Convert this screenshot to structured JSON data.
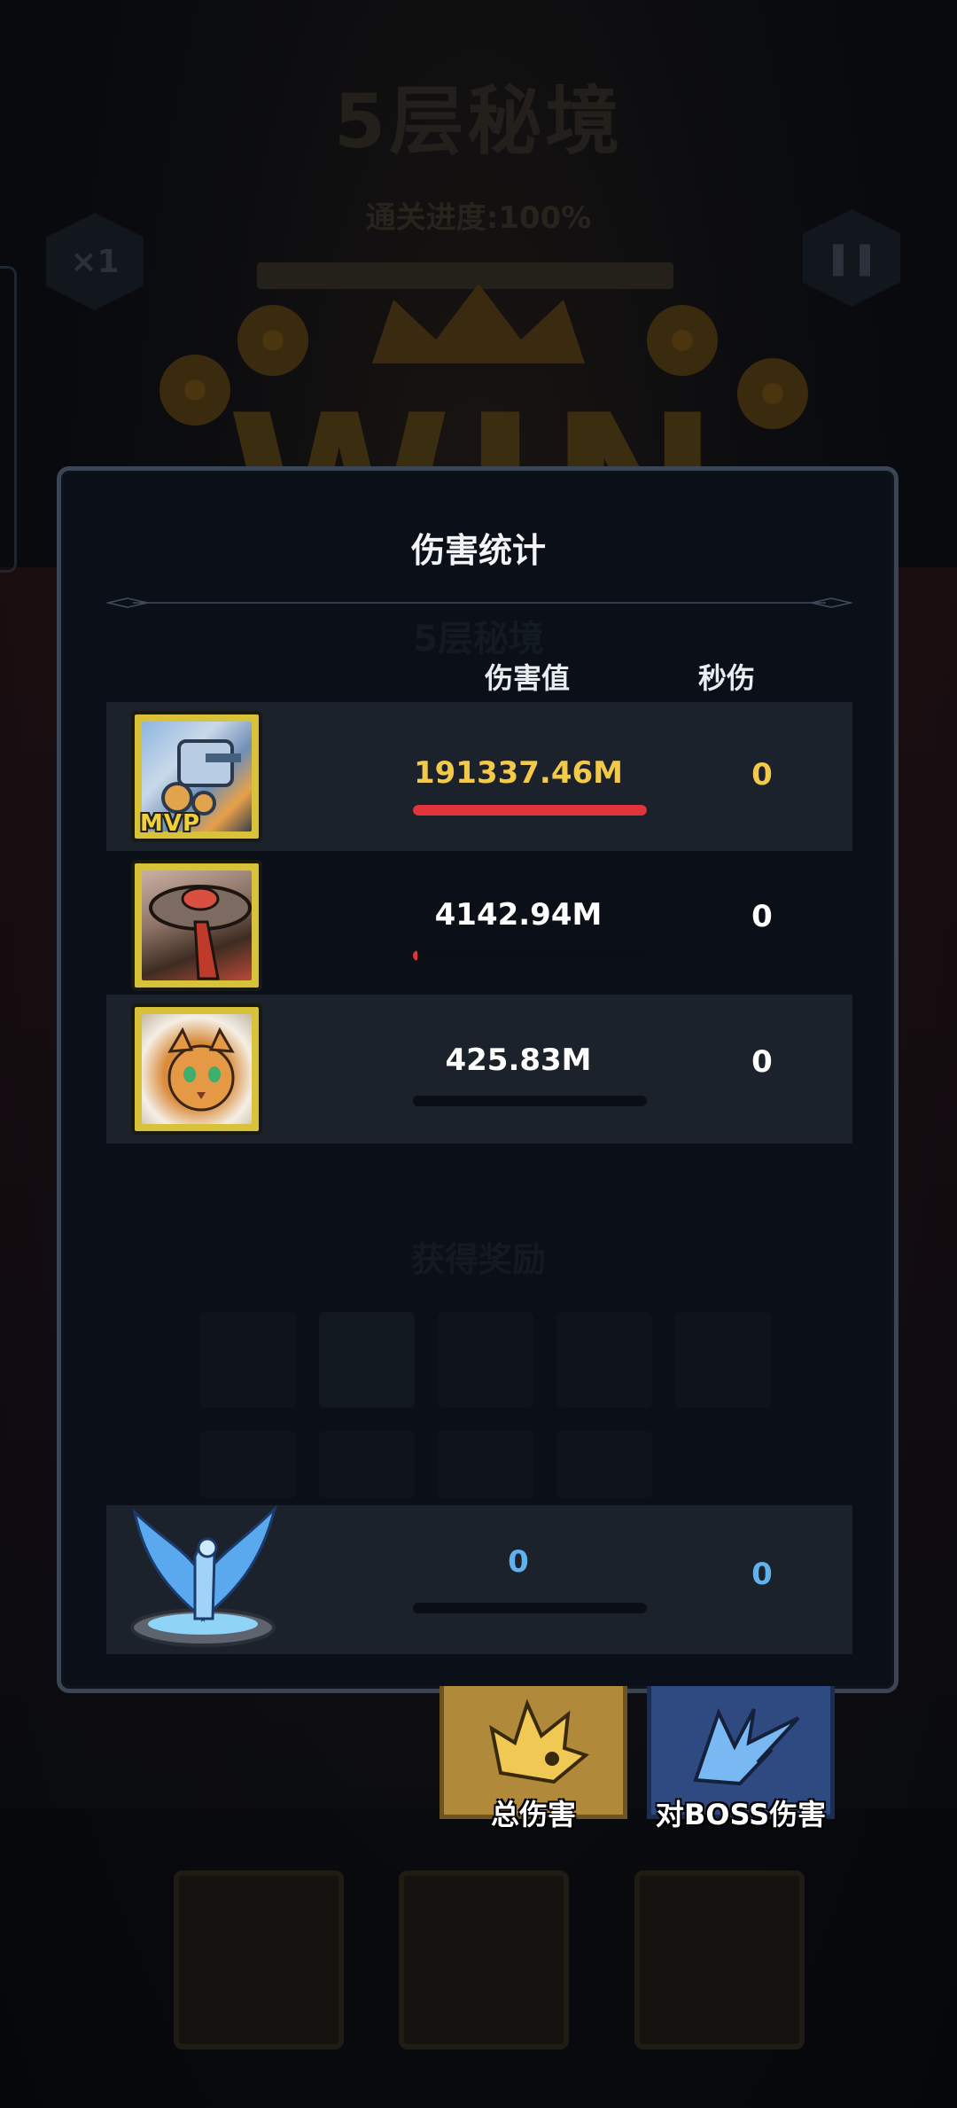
{
  "background": {
    "title": "5层秘境",
    "progress_text": "通关进度:100%",
    "speed_label": "×1",
    "win_text": "WIN",
    "panel_subtitle": "5层秘境",
    "rewards_label": "获得奖励"
  },
  "panel": {
    "title": "伤害统计",
    "col_damage": "伤害值",
    "col_dps": "秒伤"
  },
  "rows": [
    {
      "hero": "mech-hero",
      "mvp": "MVP",
      "damage": "191337.46M",
      "dps": "0",
      "bar_fraction": 1.0,
      "damage_color": "#f3c94a"
    },
    {
      "hero": "ufo-hero",
      "damage": "4142.94M",
      "dps": "0",
      "bar_fraction": 0.02,
      "damage_color": "#ffffff"
    },
    {
      "hero": "lynx-hero",
      "damage": "425.83M",
      "dps": "0",
      "bar_fraction": 0.0,
      "damage_color": "#ffffff"
    }
  ],
  "pet_row": {
    "pet": "ice-phoenix-pet",
    "damage": "0",
    "dps": "0",
    "bar_fraction": 0.0,
    "value_color": "#5fb2ec"
  },
  "tabs": {
    "total": "总伤害",
    "boss": "对BOSS伤害"
  },
  "colors": {
    "panel_bg": "#0b1018",
    "panel_border": "#3a4656",
    "row_alt": "#1c222b",
    "bar_red": "#e0353a",
    "mvp_gold": "#f0cf3c",
    "tab_total": "#b08a3a",
    "tab_boss": "#2f4a80"
  }
}
